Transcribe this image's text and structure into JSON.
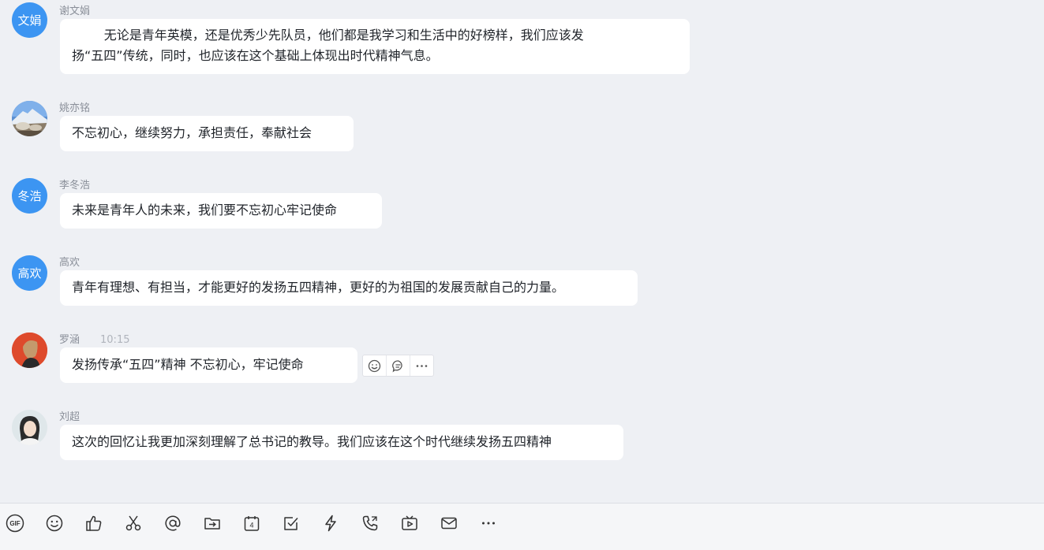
{
  "messages": [
    {
      "avatar_text": "文娟",
      "sender": "谢文娟",
      "text": "        无论是青年英模，还是优秀少先队员，他们都是我学习和生活中的好榜样，我们应该发\n扬“五四”传统，同时，也应该在这个基础上体现出时代精神气息。"
    },
    {
      "avatar_text": "",
      "sender": "姚亦铭",
      "text": "不忘初心，继续努力，承担责任，奉献社会"
    },
    {
      "avatar_text": "冬浩",
      "sender": "李冬浩",
      "text": "未来是青年人的未来，我们要不忘初心牢记使命"
    },
    {
      "avatar_text": "高欢",
      "sender": "高欢",
      "text": "青年有理想、有担当，才能更好的发扬五四精神，更好的为祖国的发展贡献自己的力量。"
    },
    {
      "avatar_text": "",
      "sender": "罗涵",
      "time": "10:15",
      "text": "发扬传承“五四”精神 不忘初心，牢记使命"
    },
    {
      "avatar_text": "",
      "sender": "刘超",
      "text": "这次的回忆让我更加深刻理解了总书记的教导。我们应该在这个时代继续发扬五四精神"
    }
  ],
  "hover_actions": [
    "emoji-reaction-icon",
    "reply-comment-icon",
    "more-icon"
  ],
  "toolbar": [
    "gif-icon",
    "emoji-icon",
    "thumbs-up-icon",
    "scissors-icon",
    "mention-icon",
    "folder-send-icon",
    "calendar-icon",
    "checkbox-icon",
    "lightning-icon",
    "phone-call-icon",
    "video-icon",
    "mail-icon",
    "more-icon"
  ],
  "colors": {
    "avatar_blue": "#3c95f2",
    "background": "#eef0f4",
    "bubble": "#ffffff"
  }
}
